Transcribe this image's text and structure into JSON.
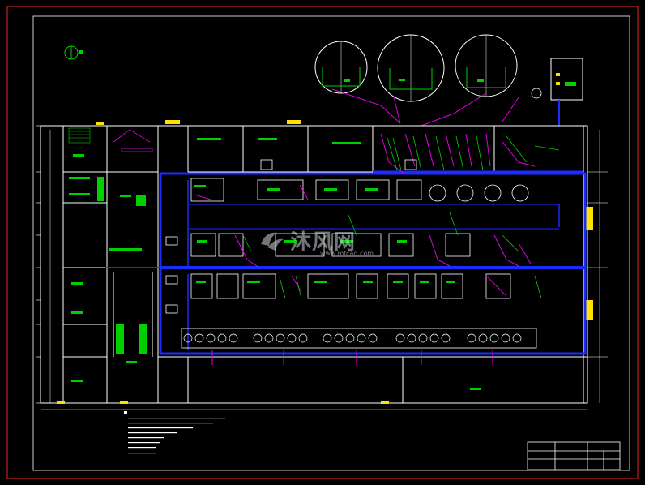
{
  "watermark": {
    "brand": "沐风网",
    "url": "www.mfcad.com"
  },
  "colors": {
    "background": "#000000",
    "outer_frame": "#c81e1e",
    "inner_frame": "#ffffff",
    "walls": "#ffffff",
    "duct": "#1a2cff",
    "equipment": "#00d000",
    "pipes": "#e000e0",
    "grid_marks": "#ffe000",
    "title_block": "#ffffff"
  },
  "icons": [
    "north-arrow-icon",
    "logo-icon"
  ]
}
